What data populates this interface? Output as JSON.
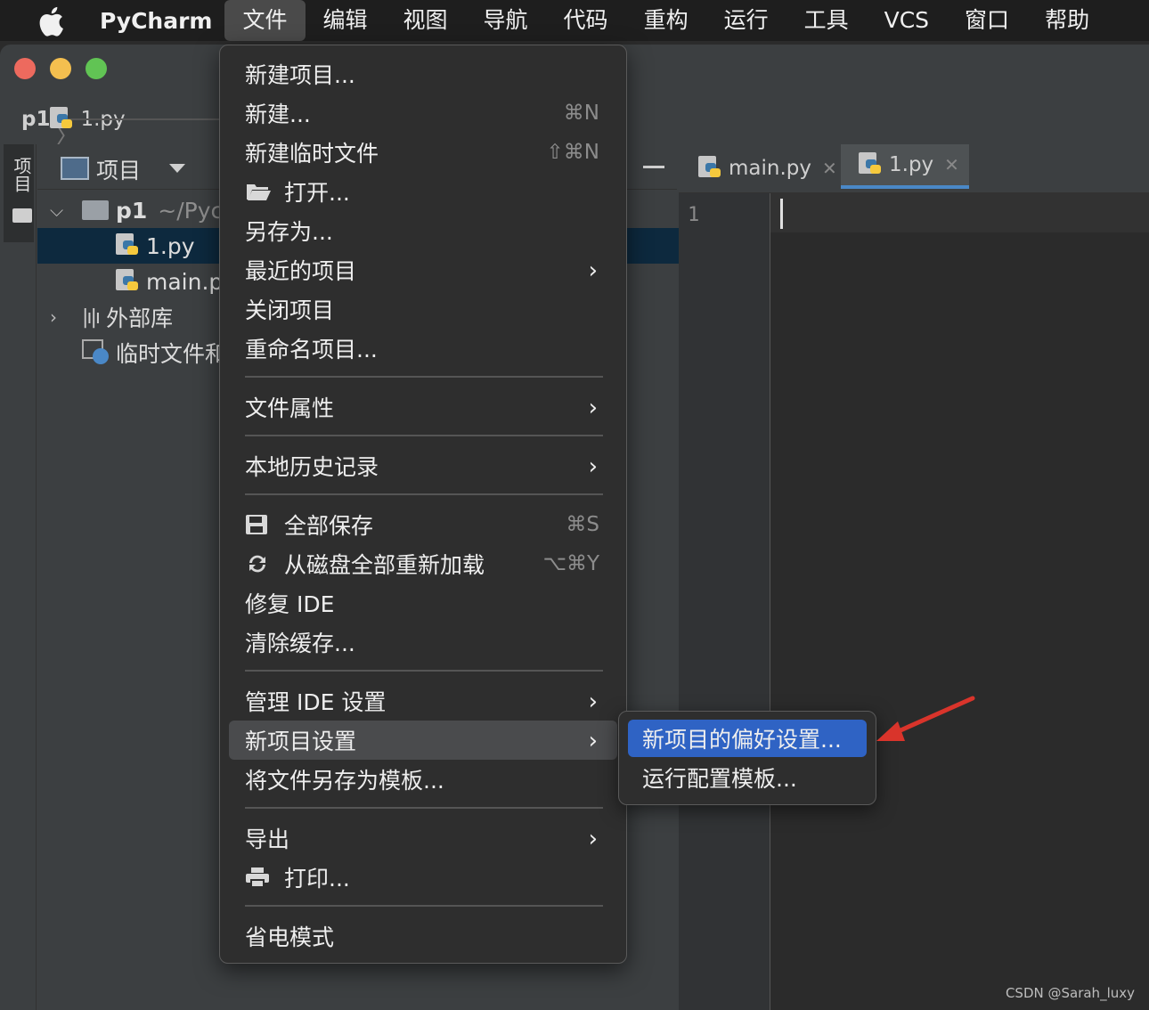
{
  "menubar": {
    "app_name": "PyCharm",
    "items": [
      "文件",
      "编辑",
      "视图",
      "导航",
      "代码",
      "重构",
      "运行",
      "工具",
      "VCS",
      "窗口",
      "帮助"
    ]
  },
  "breadcrumb": {
    "project": "p1",
    "file": "1.py"
  },
  "tool_strip": {
    "label": "项目"
  },
  "project_panel": {
    "title": "项目",
    "tree": {
      "root_name": "p1",
      "root_path": "~/Pych",
      "file1": "1.py",
      "file2": "main.p",
      "external_libs": "外部库",
      "scratches": "临时文件和"
    }
  },
  "editor": {
    "tabs": [
      "main.py",
      "1.py"
    ],
    "active_tab": "1.py",
    "line_number": "1"
  },
  "file_menu": {
    "new_project": "新建项目...",
    "new": "新建...",
    "new_shortcut": "⌘N",
    "new_scratch": "新建临时文件",
    "new_scratch_shortcut": "⇧⌘N",
    "open": "打开...",
    "save_as": "另存为...",
    "recent_projects": "最近的项目",
    "close_project": "关闭项目",
    "rename_project": "重命名项目...",
    "file_properties": "文件属性",
    "local_history": "本地历史记录",
    "save_all": "全部保存",
    "save_all_shortcut": "⌘S",
    "reload_all": "从磁盘全部重新加载",
    "reload_all_shortcut": "⌥⌘Y",
    "repair_ide": "修复 IDE",
    "invalidate_caches": "清除缓存...",
    "manage_ide_settings": "管理 IDE 设置",
    "new_project_setup": "新项目设置",
    "save_as_template": "将文件另存为模板...",
    "export": "导出",
    "print": "打印...",
    "power_save": "省电模式"
  },
  "submenu": {
    "preferences_for_new_projects": "新项目的偏好设置...",
    "run_config_templates": "运行配置模板..."
  },
  "colors": {
    "highlight": "#2f63c4",
    "annotation_arrow": "#d9342b"
  },
  "watermark": "CSDN @Sarah_luxy"
}
